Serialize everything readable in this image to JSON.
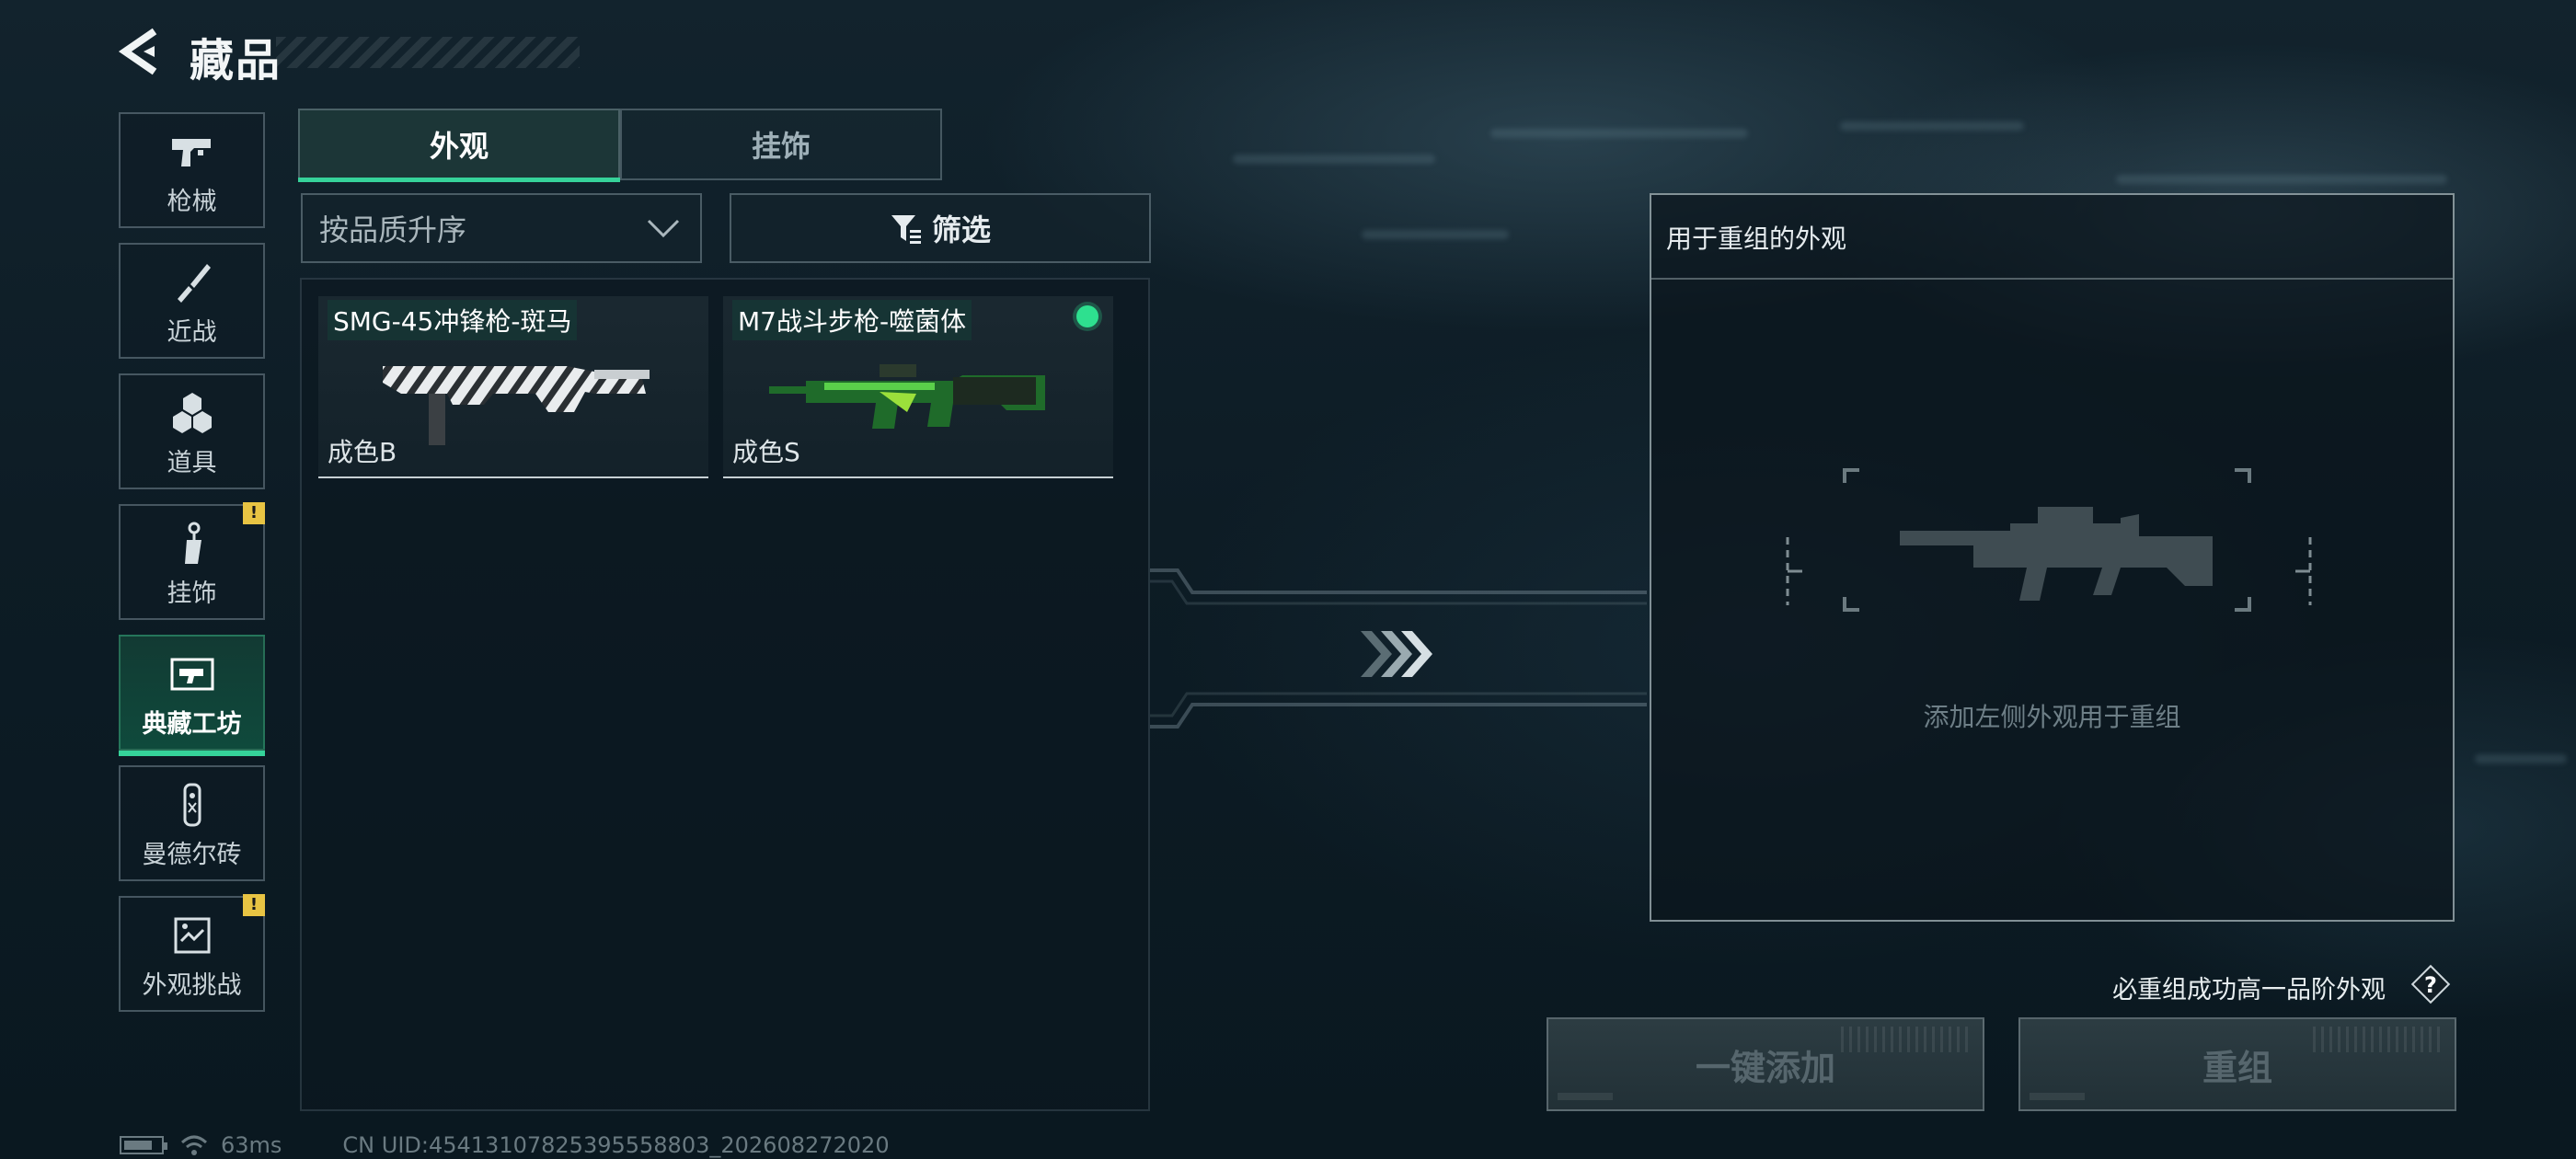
{
  "header": {
    "title": "藏品"
  },
  "nav": {
    "items": [
      {
        "label": "枪械",
        "icon": "pistol-icon",
        "active": false,
        "alert": false
      },
      {
        "label": "近战",
        "icon": "knife-icon",
        "active": false,
        "alert": false
      },
      {
        "label": "道具",
        "icon": "grenades-icon",
        "active": false,
        "alert": false
      },
      {
        "label": "挂饰",
        "icon": "charm-icon",
        "active": false,
        "alert": true
      },
      {
        "label": "典藏工坊",
        "icon": "workshop-icon",
        "active": true,
        "alert": false
      },
      {
        "label": "曼德尔砖",
        "icon": "mandel-brick-icon",
        "active": false,
        "alert": false
      },
      {
        "label": "外观挑战",
        "icon": "challenge-icon",
        "active": false,
        "alert": true
      }
    ],
    "alert_mark": "!"
  },
  "tabs": [
    {
      "label": "外观",
      "active": true
    },
    {
      "label": "挂饰",
      "active": false
    }
  ],
  "sort": {
    "value": "按品质升序"
  },
  "filter": {
    "label": "筛选"
  },
  "items": [
    {
      "name": "SMG-45冲锋枪-斑马",
      "grade": "成色B",
      "new": false
    },
    {
      "name": "M7战斗步枪-噬菌体",
      "grade": "成色S",
      "new": true
    }
  ],
  "target": {
    "header": "用于重组的外观",
    "placeholder": "添加左侧外观用于重组"
  },
  "guarantee": {
    "text": "必重组成功高一品阶外观",
    "help": "?"
  },
  "buttons": {
    "auto_add": "一键添加",
    "recombine": "重组"
  },
  "status": {
    "ping": "63ms",
    "uid": "CN UID:45413107825395558803_202608272020"
  },
  "colors": {
    "accent": "#35d39a",
    "alert": "#e8c443",
    "new_dot": "#2ee08f"
  }
}
